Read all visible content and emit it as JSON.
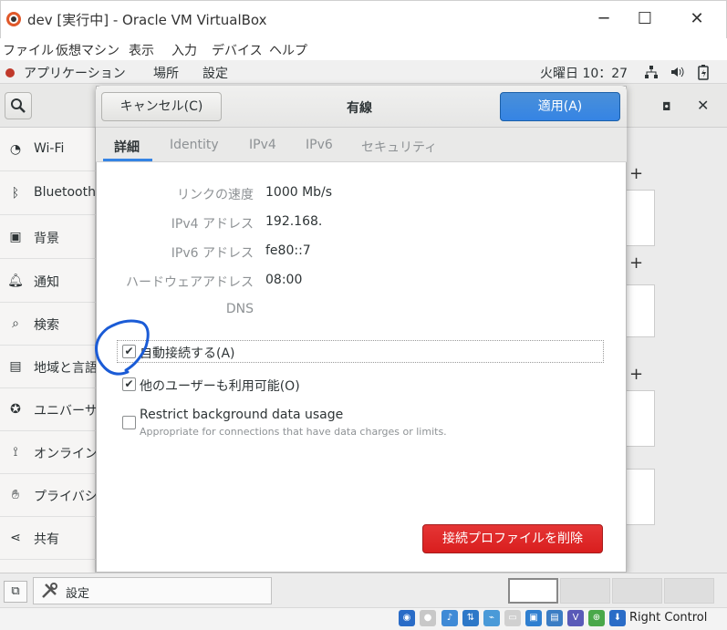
{
  "window": {
    "title": "dev [実行中] - Oracle VM VirtualBox",
    "minimize": "─",
    "maximize": "☐",
    "close": "✕"
  },
  "menubar": {
    "items": [
      "ファイル",
      "仮想マシン",
      "表示",
      "入力",
      "デバイス",
      "ヘルプ"
    ]
  },
  "gnome_bar": {
    "applications": "アプリケーション",
    "places": "場所",
    "settings": "設定",
    "clock": "火曜日 10：27"
  },
  "sidebar": {
    "items": [
      {
        "icon": "wifi-icon",
        "label": "Wi-Fi"
      },
      {
        "icon": "bluetooth-icon",
        "label": "Bluetooth"
      },
      {
        "icon": "background-icon",
        "label": "背景"
      },
      {
        "icon": "notification-icon",
        "label": "通知"
      },
      {
        "icon": "search-icon",
        "label": "検索"
      },
      {
        "icon": "region-icon",
        "label": "地域と言語"
      },
      {
        "icon": "accessibility-icon",
        "label": "ユニバーサル"
      },
      {
        "icon": "online-accounts-icon",
        "label": "オンライン"
      },
      {
        "icon": "privacy-icon",
        "label": "プライバシー"
      },
      {
        "icon": "share-icon",
        "label": "共有"
      }
    ]
  },
  "dialog": {
    "cancel": "キャンセル(C)",
    "title": "有線",
    "apply": "適用(A)",
    "tabs": [
      "詳細",
      "Identity",
      "IPv4",
      "IPv6",
      "セキュリティ"
    ],
    "props": [
      {
        "label": "リンクの速度",
        "value": "1000 Mb/s"
      },
      {
        "label": "IPv4 アドレス",
        "value": "192.168."
      },
      {
        "label": "IPv6 アドレス",
        "value": "fe80::7"
      },
      {
        "label": "ハードウェアアドレス",
        "value": "08:00"
      },
      {
        "label": "DNS",
        "value": ""
      }
    ],
    "auto_connect": {
      "label": "自動接続する(A)",
      "checked": true
    },
    "all_users": {
      "label": "他のユーザーも利用可能(O)",
      "checked": true
    },
    "restrict": {
      "label": "Restrict background data usage",
      "sub": "Appropriate for connections that have data charges or limits.",
      "checked": false
    },
    "delete_profile": "接続プロファイルを削除"
  },
  "taskbar": {
    "app_label": "設定"
  },
  "statusbar": {
    "host_key": "Right Control"
  },
  "colors": {
    "accent": "#3584e4",
    "destructive": "#e01b24",
    "annotation": "#1a5bd6"
  }
}
